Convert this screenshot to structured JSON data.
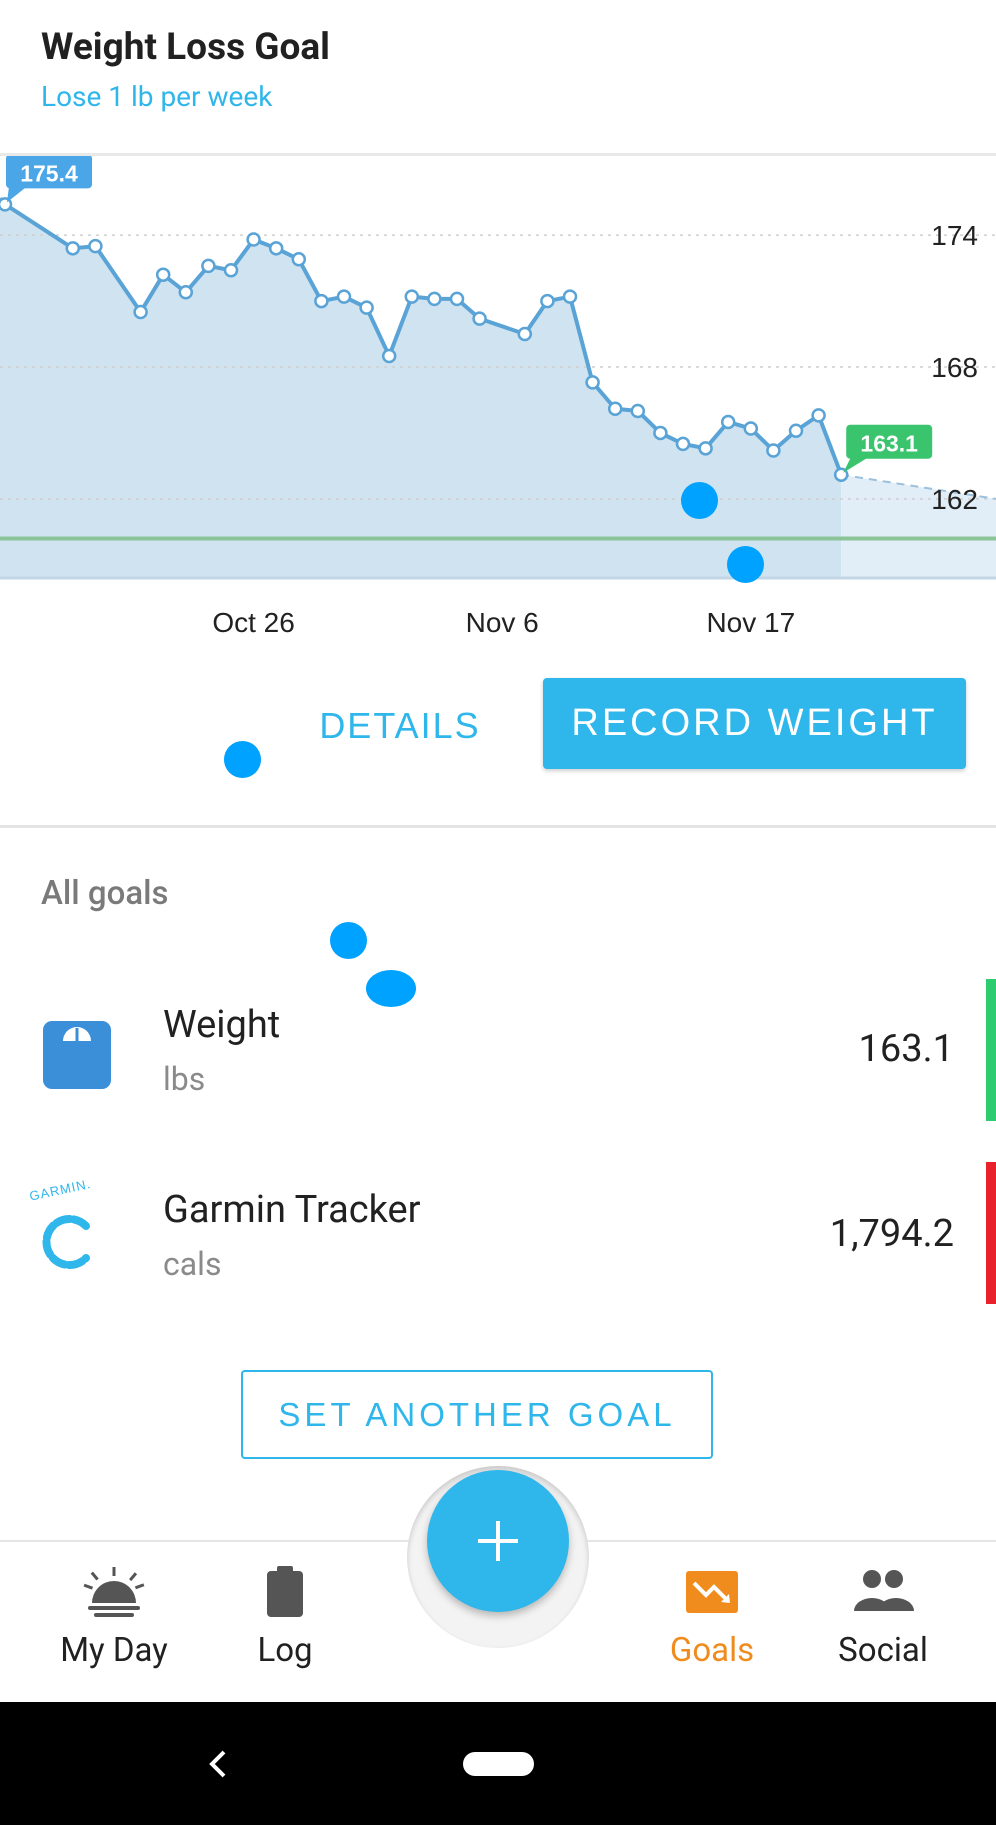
{
  "header": {
    "title": "Weight Loss Goal",
    "subtitle": "Lose 1 lb per week"
  },
  "chart_data": {
    "type": "line",
    "start_label": "175.4",
    "end_label": "163.1",
    "y_ticks": [
      "174",
      "168",
      "162"
    ],
    "x_ticks": [
      "Oct 26",
      "Nov 6",
      "Nov 17"
    ],
    "ylim": [
      158.4,
      177.6
    ],
    "goal_value": 160.2,
    "series": [
      {
        "values": [
          175.4,
          173.4,
          173.5,
          170.5,
          172.2,
          171.4,
          172.6,
          172.4,
          173.8,
          173.4,
          172.9,
          171.0,
          171.2,
          170.7,
          168.5,
          171.2,
          171.1,
          171.1,
          170.2,
          169.5,
          171.0,
          171.2,
          167.3,
          166.1,
          166.0,
          165.0,
          164.5,
          164.3,
          165.5,
          165.2,
          164.2,
          165.1,
          165.8,
          163.1
        ],
        "x": [
          "Oct 15",
          "Oct 18",
          "Oct 19",
          "Oct 21",
          "Oct 22",
          "Oct 23",
          "Oct 24",
          "Oct 25",
          "Oct 26",
          "Oct 27",
          "Oct 28",
          "Oct 29",
          "Oct 30",
          "Oct 31",
          "Nov 1",
          "Nov 2",
          "Nov 3",
          "Nov 4",
          "Nov 5",
          "Nov 7",
          "Nov 8",
          "Nov 9",
          "Nov 10",
          "Nov 11",
          "Nov 12",
          "Nov 13",
          "Nov 14",
          "Nov 15",
          "Nov 16",
          "Nov 17",
          "Nov 18",
          "Nov 19",
          "Nov 20",
          "Nov 21"
        ]
      }
    ],
    "projection": [
      163.1,
      162.0
    ],
    "colors": {
      "line": "#5aa3d6",
      "fill": "#cfe3f1",
      "projection_fill": "#e2eef7",
      "goal_line": "#8cc49a",
      "start_badge": "#4aa6e6",
      "end_badge": "#3ac46d"
    }
  },
  "actions": {
    "details": "DETAILS",
    "record_weight": "RECORD WEIGHT"
  },
  "goals": {
    "section_label": "All goals",
    "items": [
      {
        "name": "Weight",
        "unit": "lbs",
        "value": "163.1",
        "icon": "scale-icon",
        "status_color": "#2ecc71"
      },
      {
        "name": "Garmin Tracker",
        "unit": "cals",
        "value": "1,794.2",
        "icon": "garmin-icon",
        "icon_text": "GARMIN.",
        "status_color": "#e8212d"
      }
    ],
    "set_another": "SET ANOTHER GOAL"
  },
  "nav": {
    "items": [
      {
        "label": "My Day",
        "icon": "sunrise-icon",
        "active": false
      },
      {
        "label": "Log",
        "icon": "clipboard-icon",
        "active": false
      },
      {
        "label": "Goals",
        "icon": "trend-icon",
        "active": true
      },
      {
        "label": "Social",
        "icon": "people-icon",
        "active": false
      }
    ],
    "active_color": "#f08c1e"
  }
}
